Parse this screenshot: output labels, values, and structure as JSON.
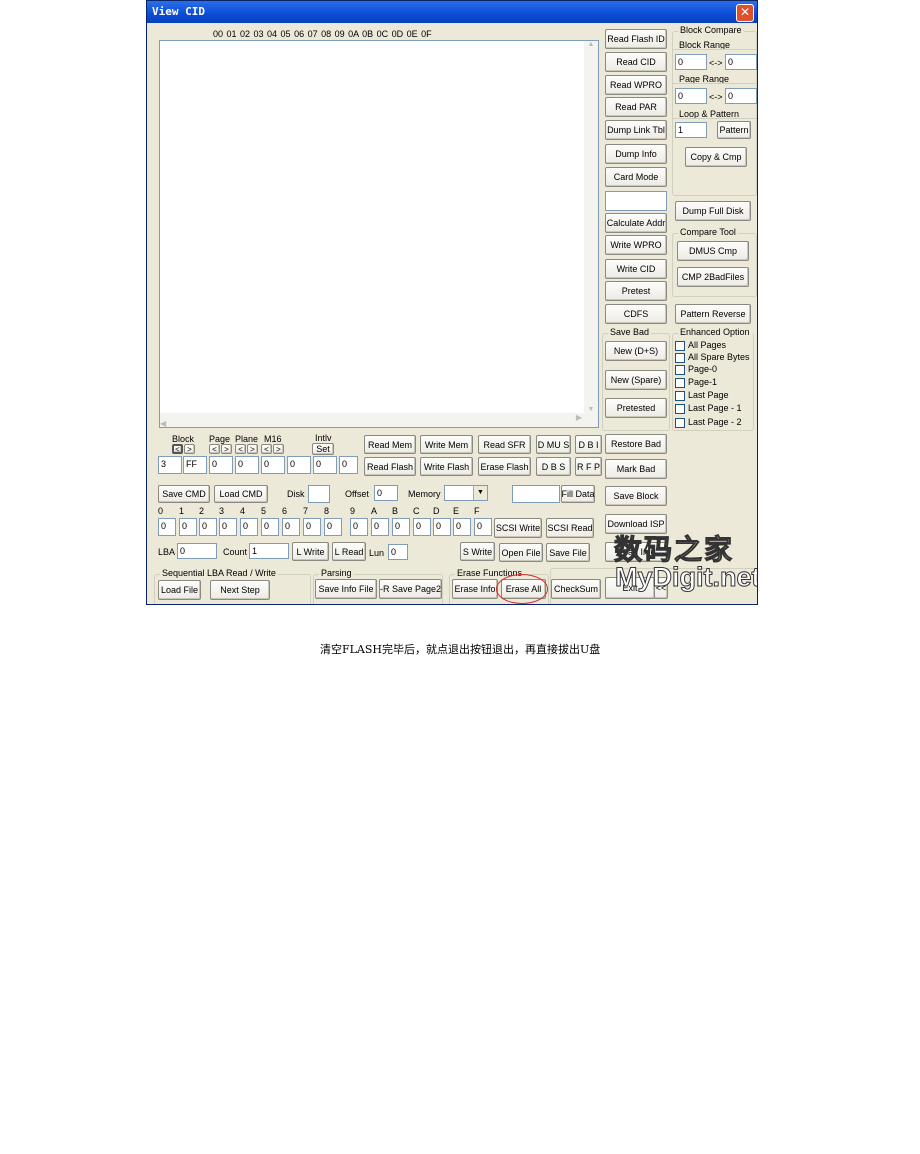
{
  "window": {
    "title": "View CID",
    "close_icon": "close-icon"
  },
  "hex_header": "00  01  02  03  04  05  06  07  08  09  0A  0B  0C  0D  0E  0F",
  "right_col": {
    "read_flash_id": "Read Flash ID",
    "read_cid": "Read CID",
    "read_wpro": "Read WPRO",
    "read_par": "Read PAR",
    "dump_link_tbl": "Dump Link Tbl",
    "dump_info": "Dump Info",
    "card_mode": "Card Mode",
    "calc_value": "",
    "calculate_addr": "Calculate Addr",
    "write_wpro": "Write WPRO",
    "write_cid": "Write CID",
    "pretest": "Pretest",
    "cdfs": "CDFS",
    "save_bad": "Save Bad",
    "new_ds": "New (D+S)",
    "new_spare": "New (Spare)",
    "pretested": "Pretested",
    "restore_bad": "Restore Bad",
    "mark_bad": "Mark Bad",
    "save_block": "Save Block",
    "download_isp": "Download ISP",
    "read_info": "Read Info",
    "exit": "Exit",
    "collapse": "<<"
  },
  "block_compare": {
    "title": "Block Compare",
    "block_range": "Block Range",
    "br_from": "0",
    "br_to": "0",
    "arrow": "<->",
    "page_range": "Page Range",
    "pr_from": "0",
    "pr_to": "0",
    "loop_pattern": "Loop & Pattern",
    "loop": "1",
    "pattern": "Pattern",
    "copy_cmp": "Copy & Cmp"
  },
  "dump_full_disk": "Dump Full Disk",
  "compare_tool": {
    "title": "Compare Tool",
    "dmus_cmp": "DMUS Cmp",
    "cmp_2badfiles": "CMP 2BadFiles"
  },
  "pattern_reverse": "Pattern Reverse",
  "enhanced": {
    "title": "Enhanced Option",
    "options": [
      {
        "label": "All Pages",
        "checked": false
      },
      {
        "label": "All Spare Bytes",
        "checked": false
      },
      {
        "label": "Page-0",
        "checked": false
      },
      {
        "label": "Page-1",
        "checked": false
      },
      {
        "label": "Last Page",
        "checked": false
      },
      {
        "label": "Last Page - 1",
        "checked": false
      },
      {
        "label": "Last Page - 2",
        "checked": false
      }
    ]
  },
  "addr": {
    "block": "Block",
    "page": "Page",
    "plane": "Plane",
    "m16": "M16",
    "intlv": "Intlv",
    "set": "Set",
    "prev": "<",
    "next": ">",
    "values": [
      "3",
      "FF",
      "0",
      "0",
      "0",
      "0",
      "0",
      "0"
    ]
  },
  "ops": {
    "read_mem": "Read Mem",
    "write_mem": "Write Mem",
    "read_sfr": "Read SFR",
    "dmus": "D MU S",
    "dbi": "D B I",
    "read_flash": "Read Flash",
    "write_flash": "Write Flash",
    "erase_flash": "Erase Flash",
    "dbs": "D B S",
    "rfp": "R F P"
  },
  "cmd": {
    "save_cmd": "Save CMD",
    "load_cmd": "Load CMD",
    "disk": "Disk",
    "disk_value": "",
    "offset": "Offset",
    "offset_value": "0",
    "memory": "Memory",
    "memory_value": "",
    "fill_value": "",
    "fill_data": "Fill Data"
  },
  "bytes": {
    "labels": [
      "0",
      "1",
      "2",
      "3",
      "4",
      "5",
      "6",
      "7",
      "8",
      "9",
      "A",
      "B",
      "C",
      "D",
      "E",
      "F"
    ],
    "values": [
      "0",
      "0",
      "0",
      "0",
      "0",
      "0",
      "0",
      "0",
      "0",
      "0",
      "0",
      "0",
      "0",
      "0",
      "0",
      "0"
    ],
    "scsi_write": "SCSI Write",
    "scsi_read": "SCSI Read"
  },
  "lba": {
    "lba": "LBA",
    "lba_value": "0",
    "count": "Count",
    "count_value": "1",
    "l_write": "L Write",
    "l_read": "L Read",
    "lun": "Lun",
    "lun_value": "0",
    "s_write": "S Write",
    "open_file": "Open File",
    "save_file": "Save File"
  },
  "sequential": {
    "title": "Sequential LBA Read / Write",
    "load_file": "Load File",
    "next_step": "Next Step"
  },
  "parsing": {
    "title": "Parsing",
    "save_info_file": "Save Info File",
    "r_save_page2": "-R Save Page2"
  },
  "erase": {
    "title": "Erase Functions",
    "erase_info": "Erase Info",
    "erase_all": "Erase All",
    "checksum": "CheckSum"
  },
  "watermark": {
    "line1": "数码之家",
    "line2": "MyDigit.net"
  },
  "caption": "清空FLASH完毕后，就点退出按钮退出，再直接拔出U盘",
  "colors": {
    "titlebar": "#0a4cd6",
    "face": "#ece9d8",
    "highlight_circle": "#d03030"
  }
}
